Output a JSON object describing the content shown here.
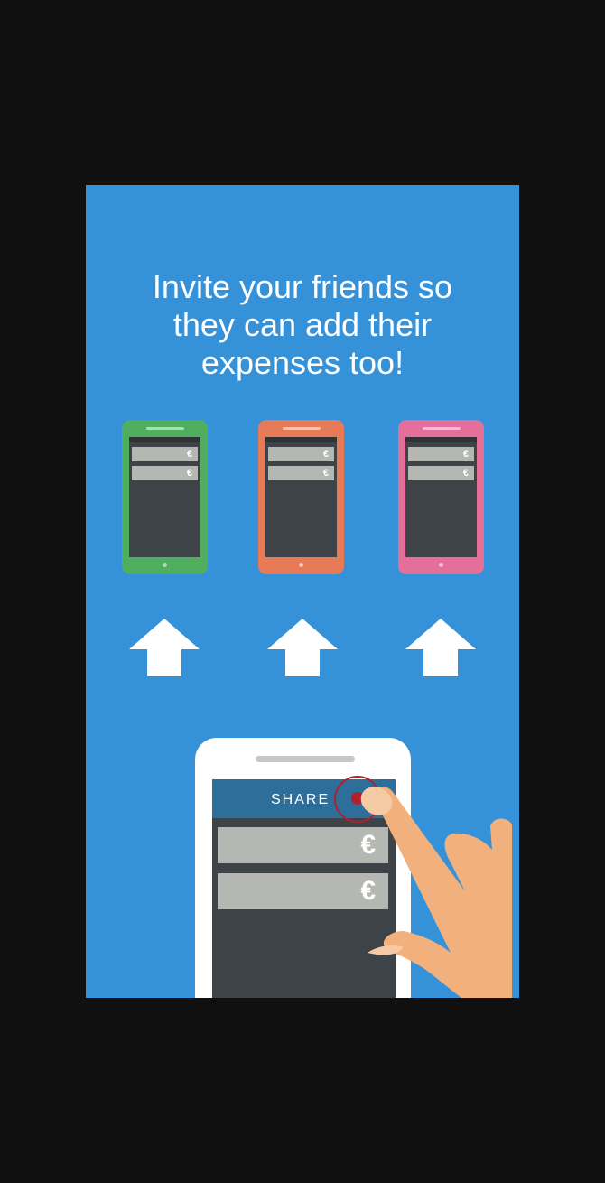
{
  "onboarding": {
    "headline_line1": "Invite your friends so",
    "headline_line2": "they can add their",
    "headline_line3": "expenses too!"
  },
  "friend_phones": [
    {
      "color": "#4faf5f",
      "rows": [
        "€",
        "€"
      ]
    },
    {
      "color": "#e77b58",
      "rows": [
        "€",
        "€"
      ]
    },
    {
      "color": "#e46f9b",
      "rows": [
        "€",
        "€"
      ]
    }
  ],
  "main_phone": {
    "share_label": "SHARE",
    "rows": [
      "€",
      "€"
    ]
  },
  "colors": {
    "background": "#3591d8",
    "share_bar": "#2e6e9a",
    "share_accent": "#b21f2e",
    "phone_screen": "#3e4348",
    "row": "#b5b8b2",
    "hand": "#f2b07c"
  },
  "icons": [
    "up-arrow-icon",
    "pointing-hand-icon"
  ]
}
